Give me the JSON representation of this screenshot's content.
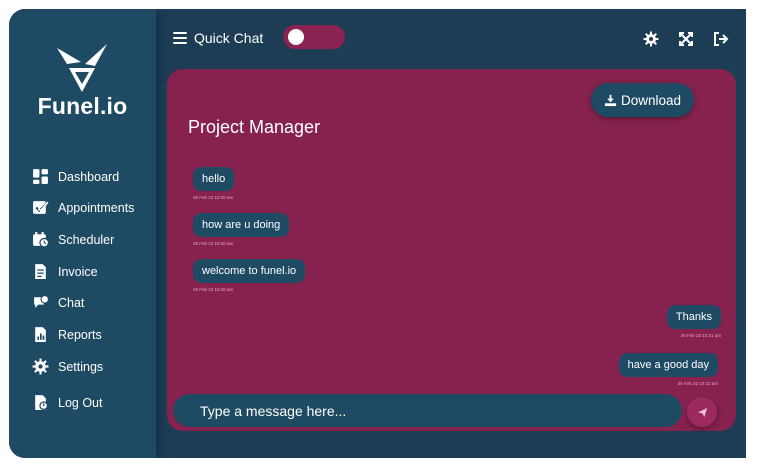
{
  "app": {
    "logo_text": "Funel.io"
  },
  "colors": {
    "frame_bg": "#1d3d55",
    "sidebar_bg": "#1f4a63",
    "chat_panel_bg": "#87224f",
    "bubble_bg": "#1f4a63",
    "toggle_bg": "#8a2252"
  },
  "sidebar": {
    "items": [
      {
        "label": "Dashboard",
        "icon": "dashboard-icon"
      },
      {
        "label": "Appointments",
        "icon": "appointments-icon"
      },
      {
        "label": "Scheduler",
        "icon": "scheduler-icon"
      },
      {
        "label": "Invoice",
        "icon": "invoice-icon"
      },
      {
        "label": "Chat",
        "icon": "chat-icon"
      },
      {
        "label": "Reports",
        "icon": "reports-icon"
      },
      {
        "label": "Settings",
        "icon": "settings-icon"
      },
      {
        "label": "Log Out",
        "icon": "logout-icon"
      }
    ]
  },
  "header": {
    "menu_icon": "hamburger-icon",
    "quick_chat_label": "Quick Chat",
    "quick_chat_enabled": false,
    "icons": [
      "gear-icon",
      "fullscreen-icon",
      "logout-icon"
    ]
  },
  "chat": {
    "title": "Project Manager",
    "download_label": "Download",
    "messages": [
      {
        "text": "hello",
        "time": "25 Feb 22 10:20 am",
        "side": "left"
      },
      {
        "text": "how are u doing",
        "time": "25 Feb 22 10:20 am",
        "side": "left"
      },
      {
        "text": "welcome to funel.io",
        "time": "25 Feb 22 10:20 am",
        "side": "left"
      },
      {
        "text": "Thanks",
        "time": "25 Feb 22 10:21 am",
        "side": "right"
      },
      {
        "text": "have a good day",
        "time": "25 Feb 22 10:22 am",
        "side": "right"
      }
    ],
    "input_placeholder": "Type a message here...",
    "send_icon": "send-icon"
  }
}
